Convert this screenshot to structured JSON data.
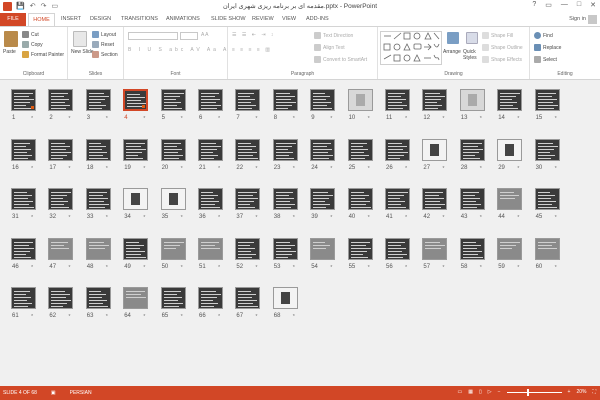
{
  "window": {
    "title": "مقدمه ای بر برنامه ریزی شهری ایران.pptx - PowerPoint",
    "controls": [
      "?",
      "▭",
      "—",
      "□",
      "✕"
    ]
  },
  "quick_access": [
    "💾",
    "↶",
    "↷",
    "▭"
  ],
  "tabs": [
    "FILE",
    "HOME",
    "INSERT",
    "DESIGN",
    "TRANSITIONS",
    "ANIMATIONS",
    "SLIDE SHOW",
    "REVIEW",
    "VIEW",
    "ADD-INS"
  ],
  "active_tab": "HOME",
  "sign_in": "Sign in",
  "ribbon": {
    "clipboard": {
      "label": "Clipboard",
      "paste": "Paste",
      "cut": "Cut",
      "copy": "Copy",
      "format_painter": "Format Painter"
    },
    "slides": {
      "label": "Slides",
      "new_slide": "New Slide",
      "layout": "Layout",
      "reset": "Reset",
      "section": "Section"
    },
    "font": {
      "label": "Font"
    },
    "paragraph": {
      "label": "Paragraph",
      "text_direction": "Text Direction",
      "align_text": "Align Text",
      "convert_smartart": "Convert to SmartArt"
    },
    "drawing": {
      "label": "Drawing",
      "arrange": "Arrange",
      "quick_styles": "Quick Styles",
      "shape_fill": "Shape Fill",
      "shape_outline": "Shape Outline",
      "shape_effects": "Shape Effects"
    },
    "editing": {
      "label": "Editing",
      "find": "Find",
      "replace": "Replace",
      "select": "Select"
    }
  },
  "slides": {
    "total": 68,
    "selected": 4,
    "star": "*",
    "special": {
      "1": "dot",
      "4": "dot",
      "10": "light",
      "13": "light",
      "27": "white",
      "29": "white",
      "34": "white",
      "35": "white",
      "44": "gray",
      "47": "gray",
      "48": "gray",
      "50": "gray",
      "51": "gray",
      "54": "gray",
      "57": "gray",
      "59": "gray",
      "60": "gray",
      "64": "gray",
      "68": "white"
    }
  },
  "status": {
    "slide_info": "SLIDE 4 OF 68",
    "language": "PERSIAN",
    "zoom": "20%"
  },
  "colors": {
    "accent": "#d24726",
    "sorter_bg": "#f0f0f0",
    "slide_dark": "#3a3a3a"
  }
}
